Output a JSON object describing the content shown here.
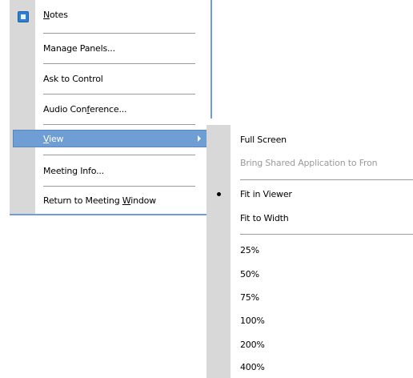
{
  "main_menu": {
    "items": [
      {
        "label_parts": [
          "",
          "N",
          "otes"
        ]
      },
      {
        "label": "Manage Panels..."
      },
      {
        "label": "Ask to Control"
      },
      {
        "label_parts": [
          "Audio Con",
          "f",
          "erence..."
        ]
      },
      {
        "label_parts": [
          "",
          "V",
          "iew"
        ]
      },
      {
        "label": "Meeting Info..."
      },
      {
        "label_parts": [
          "Return to Meeting ",
          "W",
          "indow"
        ]
      }
    ],
    "notes_icon": "notes-icon",
    "submenu_arrow_icon": "chevron-right-icon"
  },
  "sub_menu": {
    "items": [
      {
        "label": "Full Screen",
        "enabled": true
      },
      {
        "label": "Bring Shared Application to Fron",
        "enabled": false
      },
      {
        "label": "Fit in Viewer",
        "checked": true
      },
      {
        "label": "Fit to Width"
      },
      {
        "label": "25%"
      },
      {
        "label": "50%"
      },
      {
        "label": "75%"
      },
      {
        "label": "100%"
      },
      {
        "label": "200%"
      },
      {
        "label": "400%"
      }
    ]
  },
  "colors": {
    "highlight": "#6f9ed4",
    "menu_border": "#6aa0d8",
    "gutter": "#d8d8d8",
    "disabled_text": "#9a9a9a"
  }
}
